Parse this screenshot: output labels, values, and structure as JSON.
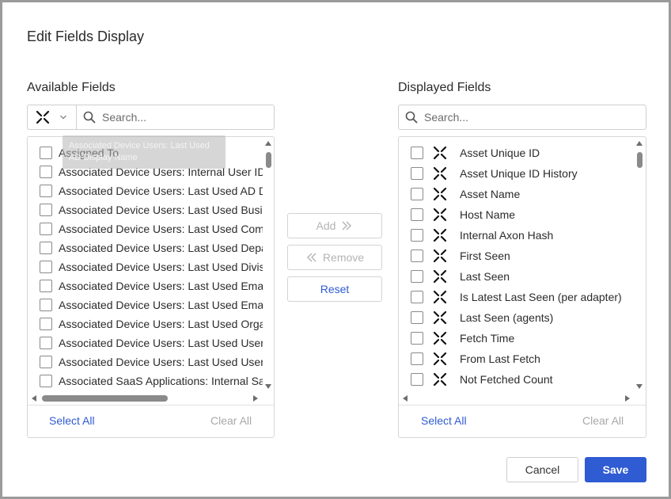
{
  "dialog": {
    "title": "Edit Fields Display"
  },
  "available": {
    "label": "Available Fields",
    "search_placeholder": "Search...",
    "adapter_filter_icon": "axonius-logo-icon",
    "tooltip": "Associated Device Users: Last Used AD Display Name",
    "items": [
      {
        "label": "Assigned To"
      },
      {
        "label": "Associated Device Users: Internal User ID"
      },
      {
        "label": "Associated Device Users: Last Used AD Display Name"
      },
      {
        "label": "Associated Device Users: Last Used Business Unit"
      },
      {
        "label": "Associated Device Users: Last Used Company"
      },
      {
        "label": "Associated Device Users: Last Used Department"
      },
      {
        "label": "Associated Device Users: Last Used Division"
      },
      {
        "label": "Associated Device Users: Last Used Email"
      },
      {
        "label": "Associated Device Users: Last Used Email Domain"
      },
      {
        "label": "Associated Device Users: Last Used Organization"
      },
      {
        "label": "Associated Device Users: Last Used User"
      },
      {
        "label": "Associated Device Users: Last Used Username"
      },
      {
        "label": "Associated SaaS Applications: Internal SaaS ID"
      }
    ],
    "select_all": "Select All",
    "clear_all": "Clear All"
  },
  "actions": {
    "add": "Add",
    "remove": "Remove",
    "reset": "Reset"
  },
  "displayed": {
    "label": "Displayed Fields",
    "search_placeholder": "Search...",
    "items": [
      {
        "label": "Asset Unique ID"
      },
      {
        "label": "Asset Unique ID History"
      },
      {
        "label": "Asset Name"
      },
      {
        "label": "Host Name"
      },
      {
        "label": "Internal Axon Hash"
      },
      {
        "label": "First Seen"
      },
      {
        "label": "Last Seen"
      },
      {
        "label": "Is Latest Last Seen (per adapter)"
      },
      {
        "label": "Last Seen (agents)"
      },
      {
        "label": "Fetch Time"
      },
      {
        "label": "From Last Fetch"
      },
      {
        "label": "Not Fetched Count"
      }
    ],
    "select_all": "Select All",
    "clear_all": "Clear All"
  },
  "footer": {
    "cancel": "Cancel",
    "save": "Save"
  },
  "colors": {
    "accent": "#2f5bd3",
    "link": "#2f5bd3",
    "disabled_text": "#a8a8a8",
    "frame_border": "#9b9b9b"
  }
}
